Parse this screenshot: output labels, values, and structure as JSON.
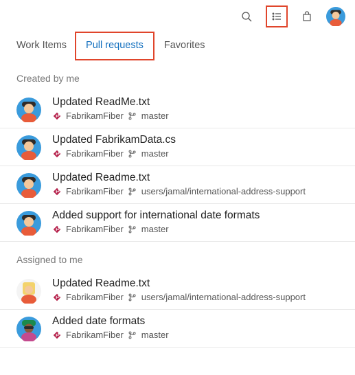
{
  "tabs": {
    "work_items": "Work Items",
    "pull_requests": "Pull requests",
    "favorites": "Favorites"
  },
  "sections": {
    "created_by_me": {
      "label": "Created by me",
      "rows": [
        {
          "title": "Updated ReadMe.txt",
          "repo": "FabrikamFiber",
          "branch": "master",
          "avatar": "blue"
        },
        {
          "title": "Updated FabrikamData.cs",
          "repo": "FabrikamFiber",
          "branch": "master",
          "avatar": "blue"
        },
        {
          "title": "Updated Readme.txt",
          "repo": "FabrikamFiber",
          "branch": "users/jamal/international-address-support",
          "avatar": "blue"
        },
        {
          "title": "Added support for international date formats",
          "repo": "FabrikamFiber",
          "branch": "master",
          "avatar": "blue"
        }
      ]
    },
    "assigned_to_me": {
      "label": "Assigned to me",
      "rows": [
        {
          "title": "Updated Readme.txt",
          "repo": "FabrikamFiber",
          "branch": "users/jamal/international-address-support",
          "avatar": "blonde"
        },
        {
          "title": "Added date formats",
          "repo": "FabrikamFiber",
          "branch": "master",
          "avatar": "green"
        }
      ]
    }
  }
}
